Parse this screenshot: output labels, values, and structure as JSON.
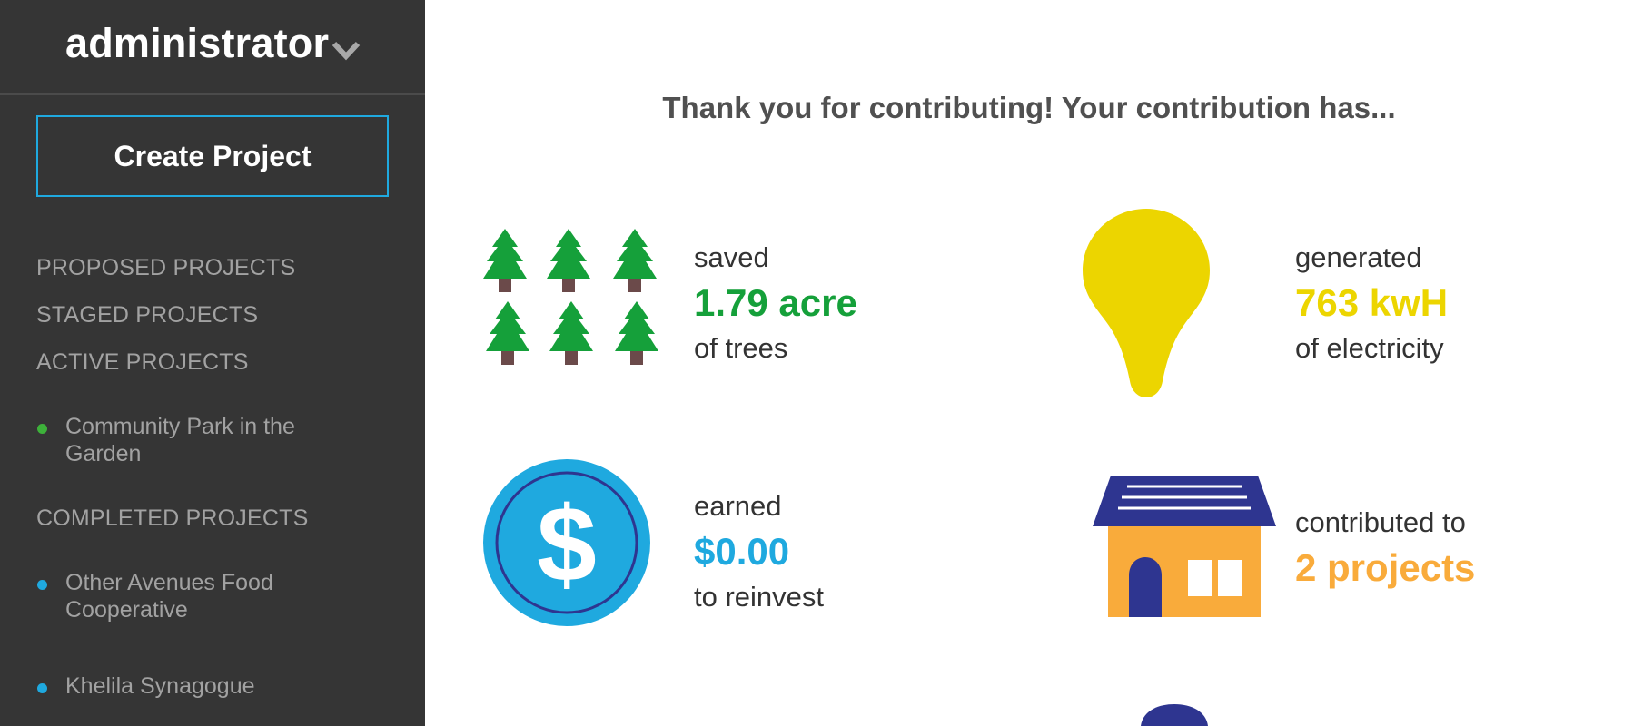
{
  "sidebar": {
    "user_name": "administrator",
    "create_button": "Create Project",
    "sections": {
      "proposed": "PROPOSED PROJECTS",
      "staged": "STAGED PROJECTS",
      "active": "ACTIVE PROJECTS",
      "completed": "COMPLETED PROJECTS"
    },
    "active_projects": [
      {
        "label": "Community Park in the Garden",
        "dot_color": "#3db13a"
      }
    ],
    "completed_projects": [
      {
        "label": "Other Avenues Food Cooperative",
        "dot_color": "#1fa9df"
      },
      {
        "label": "Khelila Synagogue",
        "dot_color": "#1fa9df"
      }
    ]
  },
  "main": {
    "headline": "Thank you for contributing! Your contribution has...",
    "stats": {
      "trees": {
        "pre": "saved",
        "value": "1.79 acre",
        "post": "of trees",
        "color": "#15a03a",
        "icon": "pine-trees-icon"
      },
      "electricity": {
        "pre": "generated",
        "value": "763 kwH",
        "post": "of electricity",
        "color": "#ecd500",
        "icon": "lightbulb-icon"
      },
      "money": {
        "pre": "earned",
        "value": "$0.00",
        "post": "to reinvest",
        "color": "#1fa9df",
        "icon": "dollar-coin-icon"
      },
      "projects": {
        "pre": "contributed to",
        "value": "2 projects",
        "post": "",
        "color": "#f9ab3b",
        "icon": "solar-house-icon"
      }
    }
  },
  "colors": {
    "sidebar_bg": "#353535",
    "accent_blue": "#1fa9df",
    "tree_green": "#15a03a",
    "trunk_brown": "#6b4a4a",
    "bulb_yellow": "#ecd500",
    "house_orange": "#f9ab3b",
    "navy": "#2e3590"
  }
}
